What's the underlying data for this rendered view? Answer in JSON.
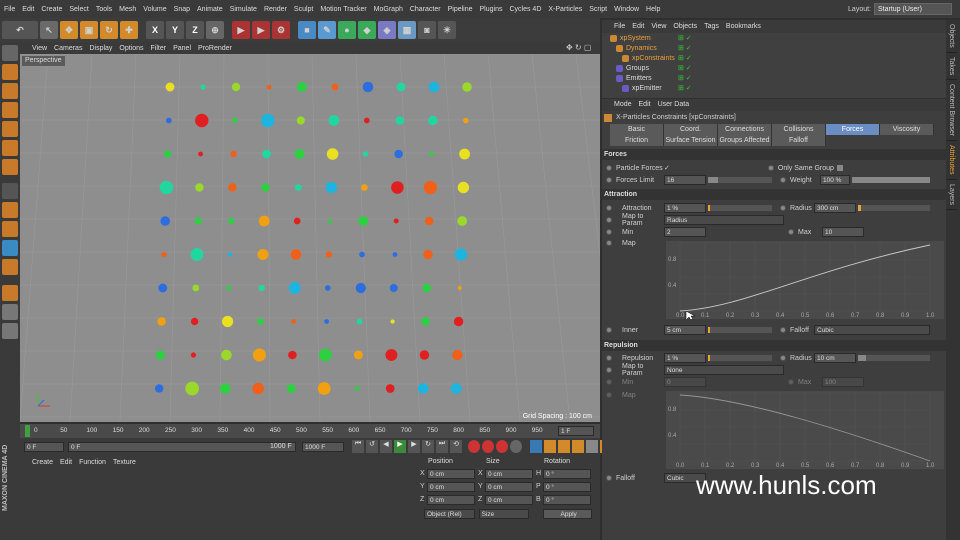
{
  "menu": [
    "File",
    "Edit",
    "Create",
    "Select",
    "Tools",
    "Mesh",
    "Volume",
    "Snap",
    "Animate",
    "Simulate",
    "Render",
    "Sculpt",
    "Motion Tracker",
    "MoGraph",
    "Character",
    "Pipeline",
    "Plugins",
    "Cycles 4D",
    "X-Particles",
    "Script",
    "Window",
    "Help"
  ],
  "layout": {
    "label": "Layout:",
    "value": "Startup (User)"
  },
  "viewport_menu": [
    "View",
    "Cameras",
    "Display",
    "Options",
    "Filter",
    "Panel",
    "ProRender"
  ],
  "viewport_label": "Perspective",
  "grid_spacing": "Grid Spacing : 100 cm",
  "ticks": [
    "0",
    "50",
    "100",
    "150",
    "200",
    "250",
    "300",
    "350",
    "400",
    "450",
    "500",
    "550",
    "600",
    "650",
    "700",
    "750",
    "800",
    "850",
    "900",
    "950",
    "100"
  ],
  "frame_end": "1 F",
  "play": {
    "start": "0 F",
    "cur": "0 F",
    "end": "1000 F",
    "end2": "1000 F"
  },
  "mat_menu": [
    "Create",
    "Edit",
    "Function",
    "Texture"
  ],
  "coords": {
    "headers": [
      "Position",
      "Size",
      "Rotation"
    ],
    "rows": [
      [
        "X",
        "0 cm",
        "X",
        "0 cm",
        "H",
        "0 °"
      ],
      [
        "Y",
        "0 cm",
        "Y",
        "0 cm",
        "P",
        "0 °"
      ],
      [
        "Z",
        "0 cm",
        "Z",
        "0 cm",
        "B",
        "0 °"
      ]
    ],
    "mode": "Object (Rel)",
    "size_mode": "Size",
    "apply": "Apply"
  },
  "objmgr": {
    "menu": [
      "File",
      "Edit",
      "View",
      "Objects",
      "Tags",
      "Bookmarks"
    ],
    "items": [
      "xpSystem",
      "Dynamics",
      "xpConstraints",
      "Groups",
      "Emitters",
      "xpEmitter"
    ]
  },
  "attr": {
    "menu": [
      "Mode",
      "Edit",
      "User Data"
    ],
    "title": "X-Particles Constraints [xpConstraints]",
    "tabs1": [
      "Basic",
      "Coord.",
      "Connections",
      "Collisions",
      "Forces",
      "Viscosity"
    ],
    "tabs2": [
      "Friction",
      "Surface Tension",
      "Groups Affected",
      "Falloff"
    ],
    "forces": {
      "section": "Forces",
      "particle_forces": "Particle Forces",
      "check": "✓",
      "only_same": "Only Same Group",
      "forces_limit": "Forces Limit",
      "forces_limit_val": "16",
      "weight": "Weight",
      "weight_val": "100 %"
    },
    "attraction": {
      "section": "Attraction",
      "attraction": "Attraction",
      "attraction_val": "1 %",
      "radius": "Radius",
      "radius_val": "300 cm",
      "map_to_param": "Map to Param",
      "map_val": "Radius",
      "min": "Min",
      "min_val": "2",
      "max": "Max",
      "max_val": "10",
      "map": "Map",
      "inner": "Inner",
      "inner_val": "5 cm",
      "falloff": "Falloff",
      "falloff_val": "Cubic"
    },
    "graph_y": [
      "0.8",
      "0.4"
    ],
    "graph_x": [
      "0.0",
      "0.1",
      "0.2",
      "0.3",
      "0.4",
      "0.5",
      "0.6",
      "0.7",
      "0.8",
      "0.9",
      "1.0"
    ],
    "repulsion": {
      "section": "Repulsion",
      "repulsion": "Repulsion",
      "repulsion_val": "1 %",
      "radius": "Radius",
      "radius_val": "10 cm",
      "map_to_param": "Map to Param",
      "map_val": "None",
      "min": "Min",
      "min_val": "0",
      "max": "Max",
      "max_val": "100",
      "map": "Map",
      "falloff": "Falloff",
      "falloff_val": "Cubic"
    },
    "graph2_y": [
      "0.8",
      "0.4"
    ],
    "graph2_x": [
      "0.0",
      "0.1",
      "0.2",
      "0.3",
      "0.4",
      "0.5",
      "0.6",
      "0.7",
      "0.8",
      "0.9",
      "1.0"
    ]
  },
  "right_tabs": [
    "Objects",
    "Takes",
    "Content Browser",
    "Attributes",
    "Layers"
  ],
  "watermark": "www.hunls.com"
}
